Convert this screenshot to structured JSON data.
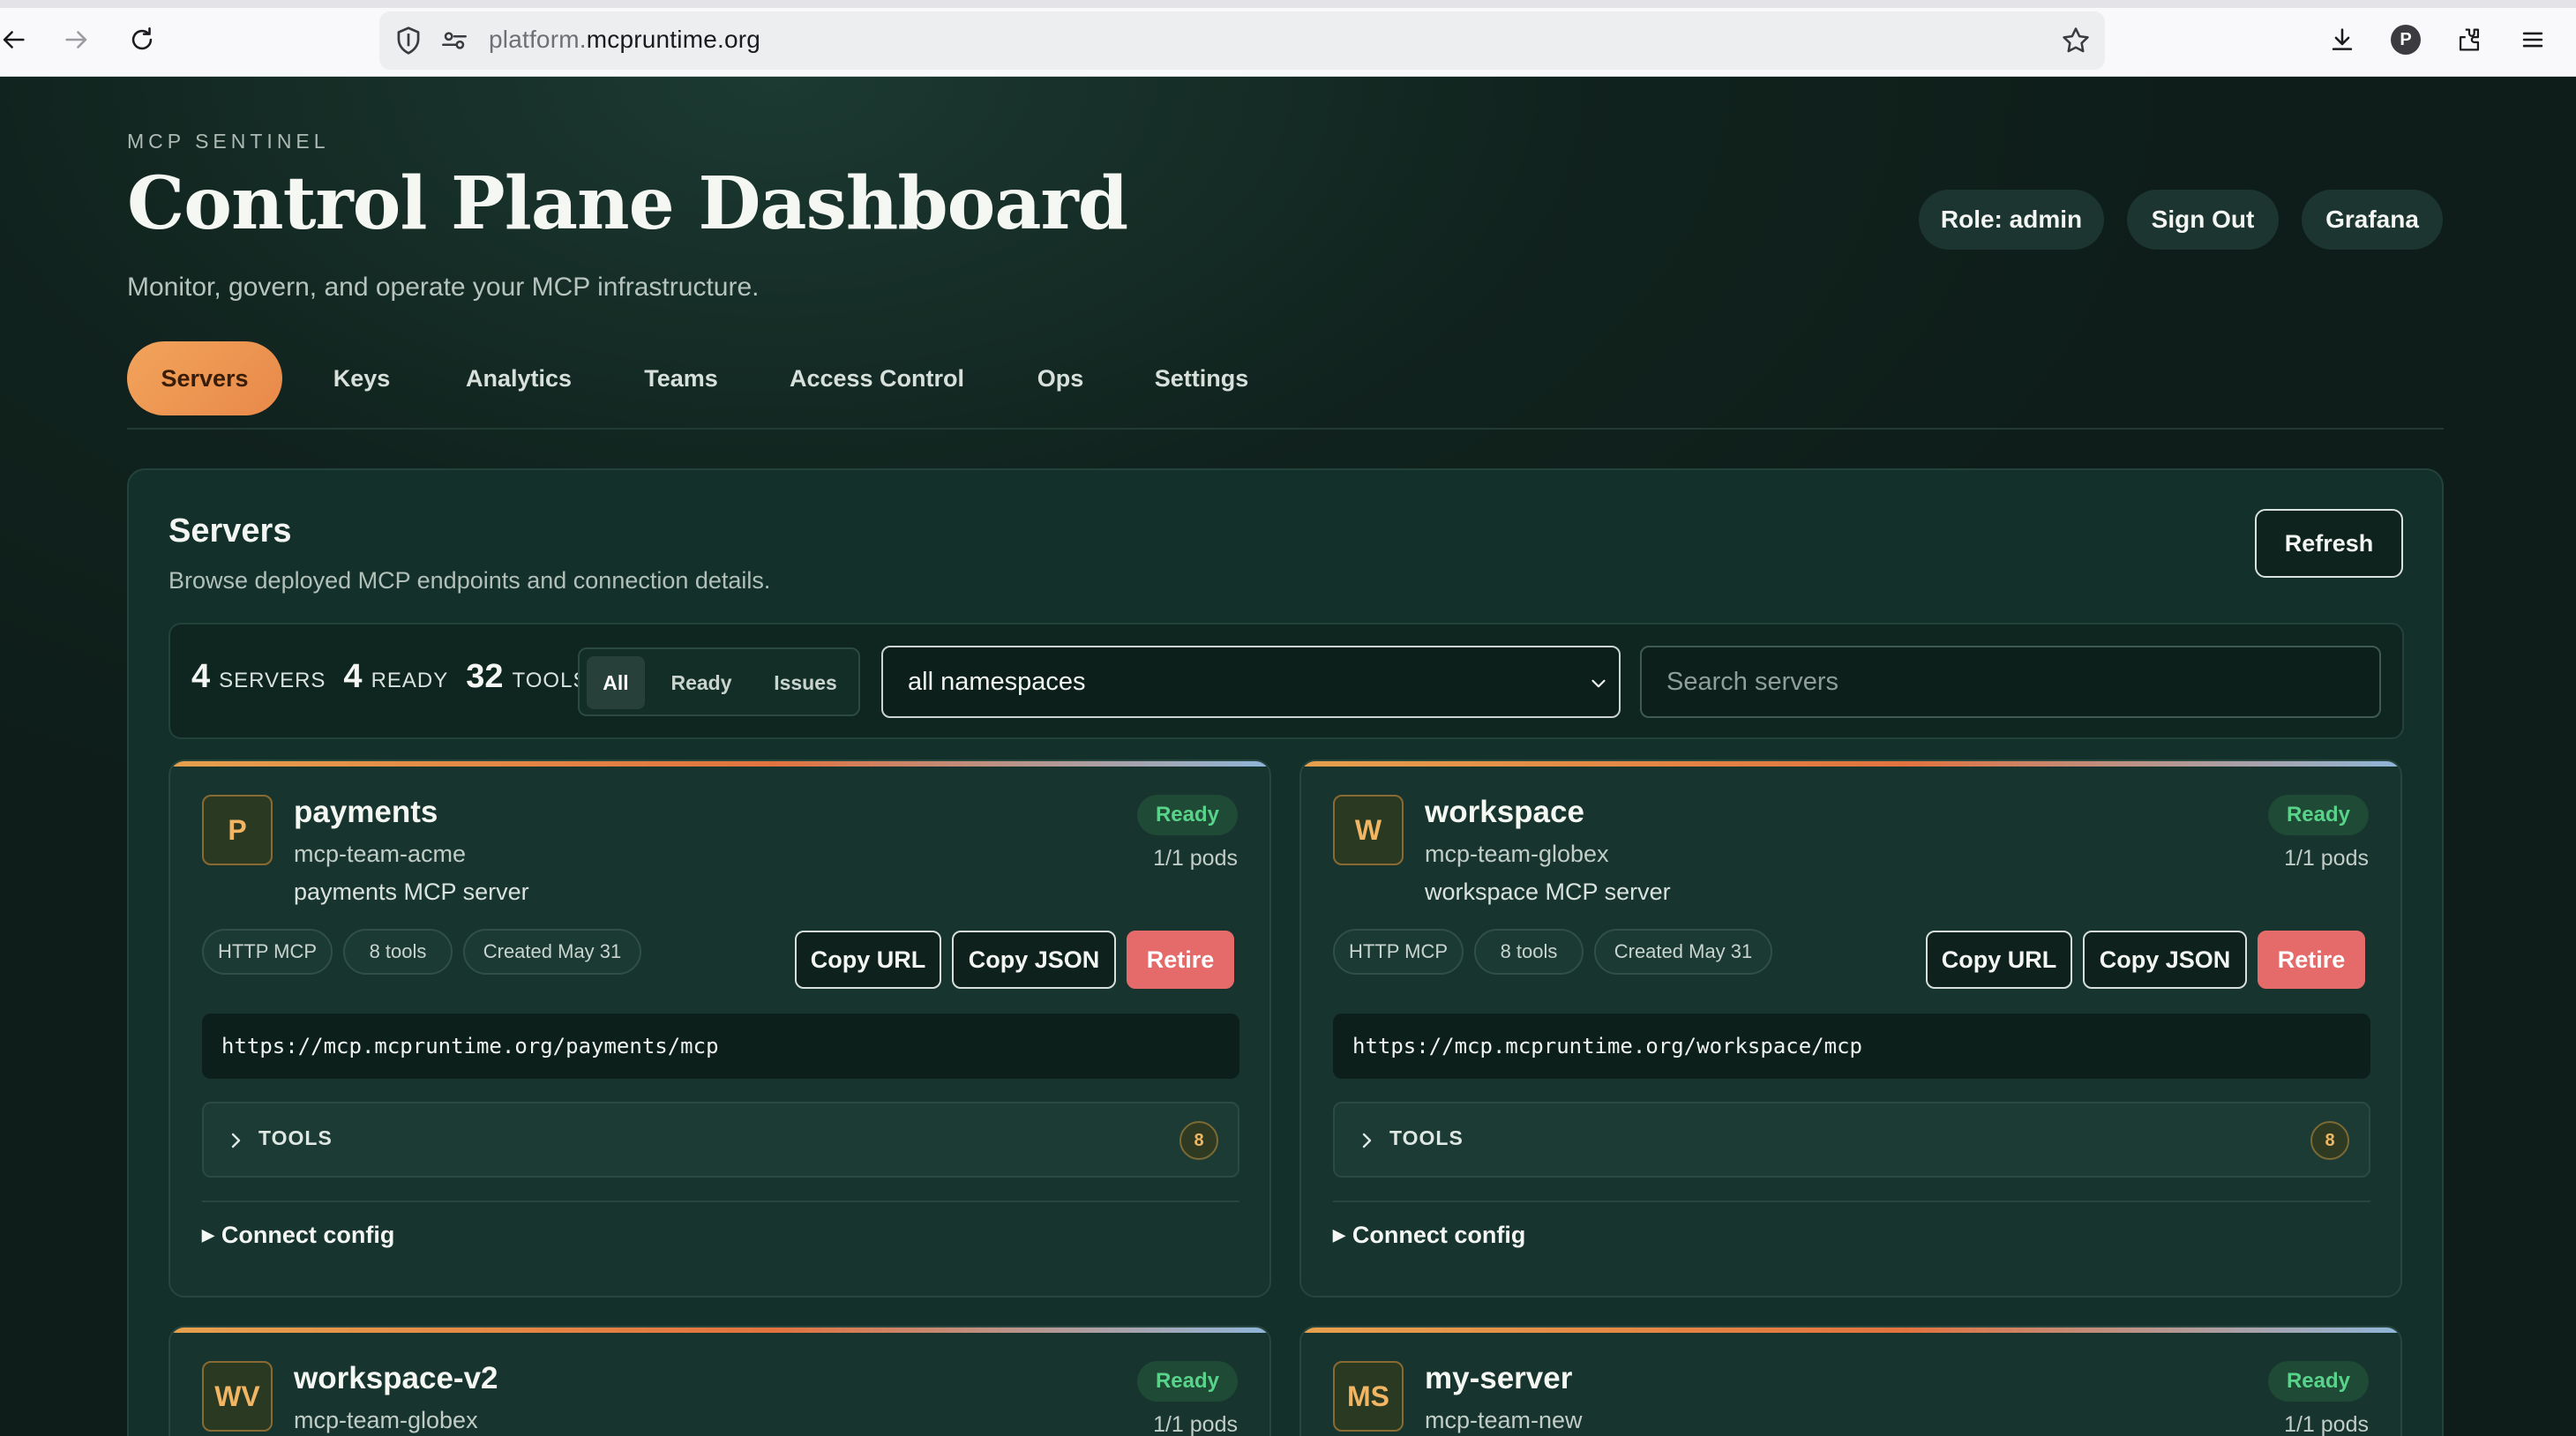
{
  "browser": {
    "url_prefix": "platform.",
    "url_domain": "mcpruntime.org",
    "profile_initial": "P",
    "icons": [
      "back-arrow-icon",
      "forward-arrow-icon",
      "reload-icon",
      "shield-icon",
      "permissions-icon",
      "bookmark-star-icon",
      "download-icon",
      "extensions-icon",
      "menu-icon"
    ]
  },
  "header": {
    "eyebrow": "MCP SENTINEL",
    "title": "Control Plane Dashboard",
    "subtitle": "Monitor, govern, and operate your MCP infrastructure.",
    "role_label": "Role: admin",
    "signout_label": "Sign Out",
    "grafana_label": "Grafana"
  },
  "tabs": [
    {
      "label": "Servers",
      "active": true
    },
    {
      "label": "Keys"
    },
    {
      "label": "Analytics"
    },
    {
      "label": "Teams"
    },
    {
      "label": "Access Control"
    },
    {
      "label": "Ops"
    },
    {
      "label": "Settings"
    }
  ],
  "servers_panel": {
    "title": "Servers",
    "subtitle": "Browse deployed MCP endpoints and connection details.",
    "refresh_label": "Refresh",
    "stats": {
      "servers_count": "4",
      "servers_label": "SERVERS",
      "ready_count": "4",
      "ready_label": "READY",
      "tools_count": "32",
      "tools_label": "TOOLS"
    },
    "filter": {
      "all": "All",
      "ready": "Ready",
      "issues": "Issues",
      "selected": "All"
    },
    "namespace_selected": "all namespaces",
    "search_placeholder": "Search servers"
  },
  "cards": [
    {
      "initials": "P",
      "name": "payments",
      "namespace": "mcp-team-acme",
      "description": "payments MCP server",
      "status": "Ready",
      "pods": "1/1 pods",
      "tags": [
        "HTTP MCP",
        "8 tools",
        "Created May 31"
      ],
      "copy_url": "Copy URL",
      "copy_json": "Copy JSON",
      "retire": "Retire",
      "url": "https://mcp.mcpruntime.org/payments/mcp",
      "tools_label": "TOOLS",
      "tools_count": "8",
      "connect_label": "Connect config"
    },
    {
      "initials": "W",
      "name": "workspace",
      "namespace": "mcp-team-globex",
      "description": "workspace MCP server",
      "status": "Ready",
      "pods": "1/1 pods",
      "tags": [
        "HTTP MCP",
        "8 tools",
        "Created May 31"
      ],
      "copy_url": "Copy URL",
      "copy_json": "Copy JSON",
      "retire": "Retire",
      "url": "https://mcp.mcpruntime.org/workspace/mcp",
      "tools_label": "TOOLS",
      "tools_count": "8",
      "connect_label": "Connect config"
    },
    {
      "initials": "WV",
      "name": "workspace-v2",
      "namespace": "mcp-team-globex",
      "status": "Ready",
      "pods": "1/1 pods"
    },
    {
      "initials": "MS",
      "name": "my-server",
      "namespace": "mcp-team-new",
      "status": "Ready",
      "pods": "1/1 pods"
    }
  ],
  "colors": {
    "accent_orange": "#f2a35b",
    "ready_green": "#59d389",
    "danger_red": "#e56a6a",
    "page_bg": "#10211c"
  }
}
